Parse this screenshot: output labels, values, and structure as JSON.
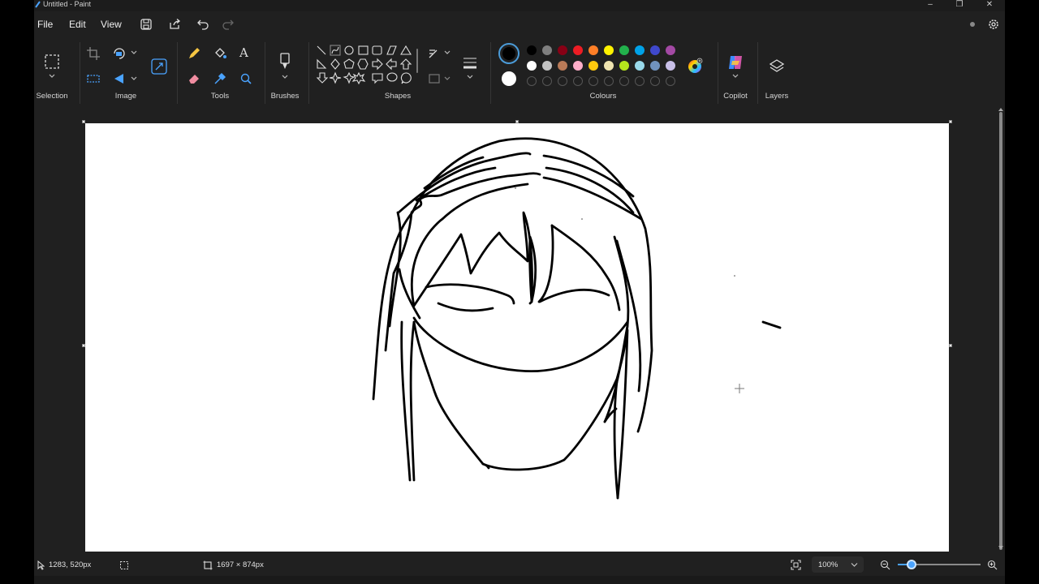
{
  "window": {
    "title": "Untitled - Paint"
  },
  "menu": {
    "file": "File",
    "edit": "Edit",
    "view": "View"
  },
  "ribbon": {
    "groups": {
      "selection": "Selection",
      "image": "Image",
      "tools": "Tools",
      "brushes": "Brushes",
      "shapes": "Shapes",
      "colours": "Colours",
      "copilot": "Copilot",
      "layers": "Layers"
    },
    "palette_row1": [
      "#000000",
      "#7f7f7f",
      "#880015",
      "#ed1c24",
      "#ff7f27",
      "#fff200",
      "#22b14c",
      "#00a2e8",
      "#3f48cc",
      "#a349a4"
    ],
    "palette_row2": [
      "#ffffff",
      "#c3c3c3",
      "#b97a57",
      "#ffaec9",
      "#ffc90e",
      "#efe4b0",
      "#b5e61d",
      "#99d9ea",
      "#7092be",
      "#c8bfe7"
    ],
    "primary_colour": "#000000",
    "secondary_colour": "#ffffff"
  },
  "status": {
    "cursor_position": "1283, 520px",
    "canvas_size": "1697 × 874px",
    "zoom": "100%"
  }
}
